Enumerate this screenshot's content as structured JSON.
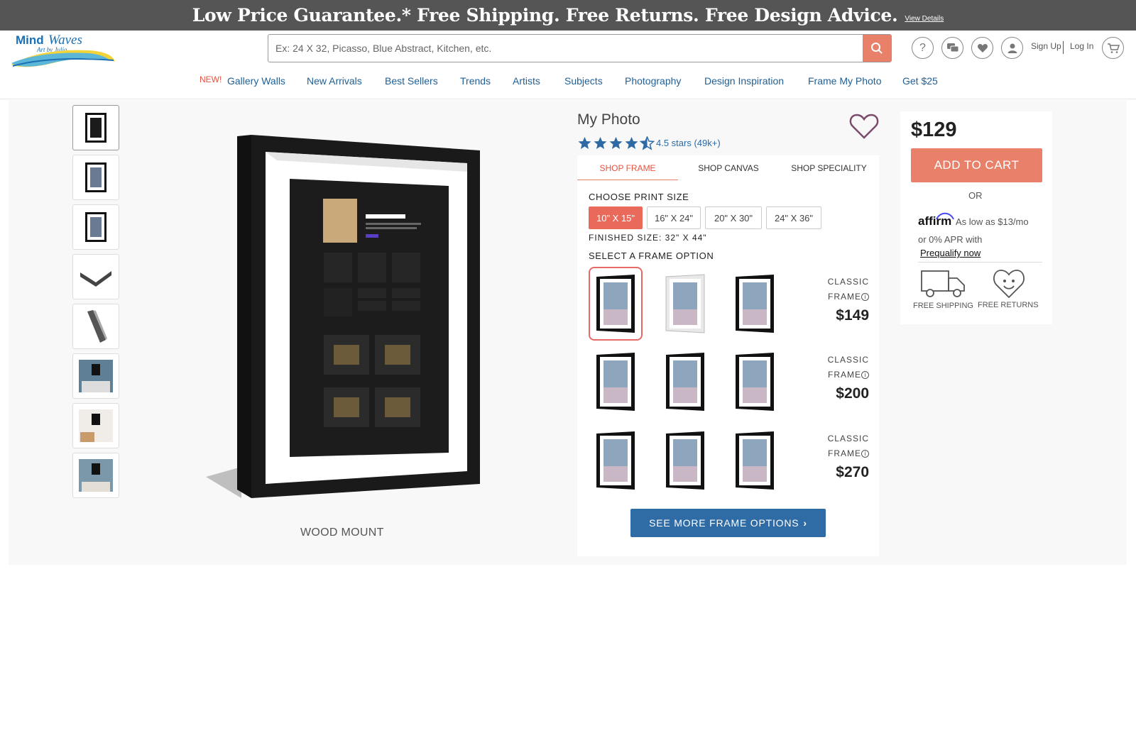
{
  "promo": {
    "text": "Low Price Guarantee.* Free Shipping. Free Returns. Free Design Advice.",
    "link": "View Details"
  },
  "logo": {
    "mind": "Mind",
    "waves": "Waves",
    "sub": "Art by Julia"
  },
  "search": {
    "placeholder": "Ex: 24 X 32, Picasso, Blue Abstract, Kitchen, etc."
  },
  "header_links": {
    "signup": "Sign Up",
    "login": "Log In"
  },
  "nav": {
    "new_badge": "NEW!",
    "items": [
      "Gallery Walls",
      "New Arrivals",
      "Best Sellers",
      "Trends",
      "Artists",
      "Subjects",
      "Photography",
      "Design Inspiration",
      "Frame My Photo",
      "Get $25"
    ]
  },
  "hero": {
    "caption": "WOOD MOUNT"
  },
  "product": {
    "title": "My Photo",
    "rating_text": "4.5 stars (49k+)",
    "rating": 4.5,
    "tabs": [
      "SHOP FRAME",
      "SHOP CANVAS",
      "SHOP SPECIALITY"
    ],
    "choose_size_label": "CHOOSE PRINT SIZE",
    "sizes": [
      "10\" X 15\"",
      "16\" X 24\"",
      "20\" X 30\"",
      "24\" X 36\""
    ],
    "finished_size": "FINISHED SIZE: 32\" X 44\"",
    "select_frame_label": "SELECT A FRAME OPTION",
    "frame_rows": [
      {
        "label_1": "CLASSIC",
        "label_2": "FRAME",
        "price": "$149"
      },
      {
        "label_1": "CLASSIC",
        "label_2": "FRAME",
        "price": "$200"
      },
      {
        "label_1": "CLASSIC",
        "label_2": "FRAME",
        "price": "$270"
      }
    ],
    "see_more": "SEE MORE FRAME OPTIONS"
  },
  "buybox": {
    "price": "$129",
    "add_to_cart": "ADD TO CART",
    "or": "OR",
    "affirm_logo": "affirm",
    "affirm_line1": "As low as $13/mo",
    "affirm_line2": "or 0% APR with",
    "prequalify": "Prequalify now",
    "free_shipping": "FREE SHIPPING",
    "free_returns": "FREE RETURNS"
  },
  "colors": {
    "accent": "#e8806a",
    "link": "#2d6aa5",
    "button_blue": "#2f6ca5",
    "promo_bg": "#555555"
  },
  "icons": [
    "search-icon",
    "help-icon",
    "chat-icon",
    "heart-icon",
    "user-icon",
    "cart-icon",
    "star-icon",
    "truck-icon",
    "heart-face-icon",
    "info-icon",
    "chevron-right-icon"
  ]
}
